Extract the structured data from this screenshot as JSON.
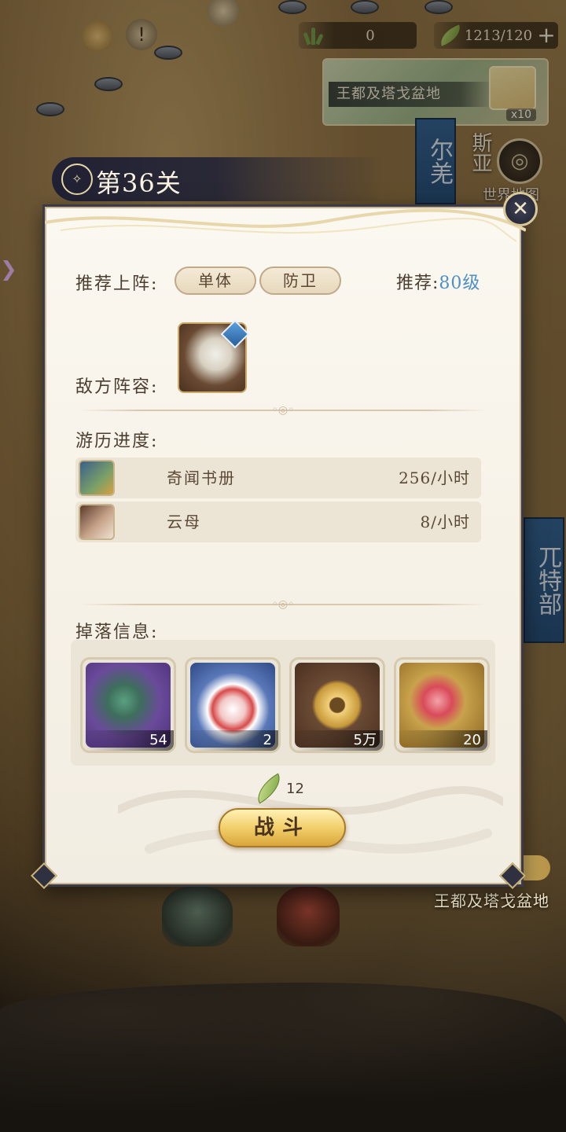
{
  "topbar": {
    "resource1_value": "0",
    "resource2_value": "1213/120",
    "resource1_icon": "grass-icon",
    "resource2_icon": "leaf-icon",
    "plus_label": "+"
  },
  "region_card": {
    "name": "王都及塔戈盆地",
    "count": "x10"
  },
  "map": {
    "banner_left": "尔羌",
    "banner_right_partial": "斯亚",
    "world_map_label": "世界地图",
    "banner_lower": "兀特部",
    "bottom_region": "王都及塔戈盆地"
  },
  "stage": {
    "title": "第36关"
  },
  "dialog": {
    "close_label": "✕",
    "recommend_label": "推荐上阵:",
    "recommend_tags": [
      "单体",
      "防卫"
    ],
    "recommend_level_label": "推荐:",
    "recommend_level_value": "80级",
    "enemy_label": "敌方阵容:",
    "progress_label": "游历进度:",
    "progress_items": [
      {
        "name": "奇闻书册",
        "rate": "256/小时"
      },
      {
        "name": "云母",
        "rate": "8/小时"
      }
    ],
    "drop_label": "掉落信息:",
    "drops": [
      {
        "count": "54"
      },
      {
        "count": "2"
      },
      {
        "count": "5万"
      },
      {
        "count": "20"
      }
    ],
    "cost_value": "12",
    "fight_label": "战斗"
  },
  "colors": {
    "accent_blue": "#4d8fc6",
    "fight_gold": "#f2cf6a",
    "panel_bg": "#fbf8f1"
  }
}
